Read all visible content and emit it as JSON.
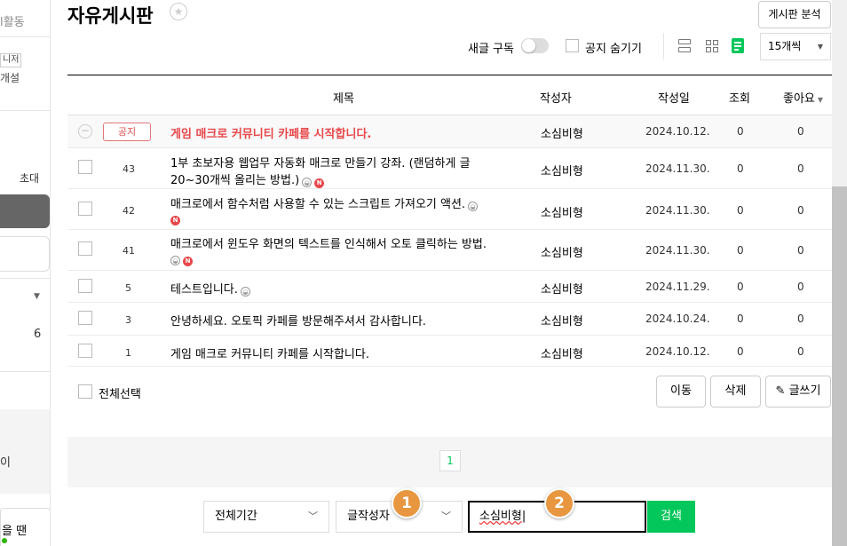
{
  "sidebar": {
    "activity_fragment": "l활동",
    "manager_fragment": "니저",
    "open_fragment": "개설",
    "invite": "초대",
    "count": "6",
    "i_fragment": "이",
    "when_fragment": "을 땐"
  },
  "header": {
    "title": "자유게시판",
    "analysis_button": "게시판 분석",
    "new_post_subscribe": "새글 구독",
    "hide_notice": "공지 숨기기",
    "per_page": "15개씩"
  },
  "table": {
    "columns": {
      "title": "제목",
      "author": "작성자",
      "date": "작성일",
      "views": "조회",
      "likes": "좋아요"
    },
    "notice": {
      "badge": "공지",
      "title": "게임 매크로 커뮤니티 카페를 시작합니다.",
      "author": "소심비형",
      "date": "2024.10.12.",
      "views": "0",
      "likes": "0"
    },
    "rows": [
      {
        "num": "43",
        "title_line1": "1부 초보자용 웹업무 자동화 매크로 만들기 강좌. (랜덤하게 글",
        "title_line2": "20~30개씩 올리는 방법.)",
        "author": "소심비형",
        "date": "2024.11.30.",
        "views": "0",
        "likes": "0"
      },
      {
        "num": "42",
        "title_line1": "매크로에서 함수처럼 사용할 수 있는 스크립트 가져오기 액션.",
        "author": "소심비형",
        "date": "2024.11.30.",
        "views": "0",
        "likes": "0"
      },
      {
        "num": "41",
        "title_line1": "매크로에서 윈도우 화면의 텍스트를 인식해서 오토 클릭하는 방법.",
        "author": "소심비형",
        "date": "2024.11.30.",
        "views": "0",
        "likes": "0"
      },
      {
        "num": "5",
        "title_line1": "테스트입니다.",
        "author": "소심비형",
        "date": "2024.11.29.",
        "views": "0",
        "likes": "0"
      },
      {
        "num": "3",
        "title_line1": "안녕하세요. 오토픽 카페를 방문해주셔서 감사합니다.",
        "author": "소심비형",
        "date": "2024.10.24.",
        "views": "0",
        "likes": "0"
      },
      {
        "num": "1",
        "title_line1": "게임 매크로 커뮤니티 카페를 시작합니다.",
        "author": "소심비형",
        "date": "2024.10.12.",
        "views": "0",
        "likes": "0"
      }
    ]
  },
  "actions": {
    "select_all": "전체선택",
    "move": "이동",
    "delete": "삭제",
    "write": "글쓰기"
  },
  "pagination": {
    "current": "1"
  },
  "search": {
    "period": "전체기간",
    "type": "글작성자",
    "query": "소심비형",
    "button": "검색"
  },
  "annotations": {
    "step1": "1",
    "step2": "2"
  },
  "icons": {
    "img": "picture-icon",
    "new": "N"
  },
  "colors": {
    "accent": "#03c75a",
    "notice": "#e8474a",
    "step": "#e8963f"
  }
}
